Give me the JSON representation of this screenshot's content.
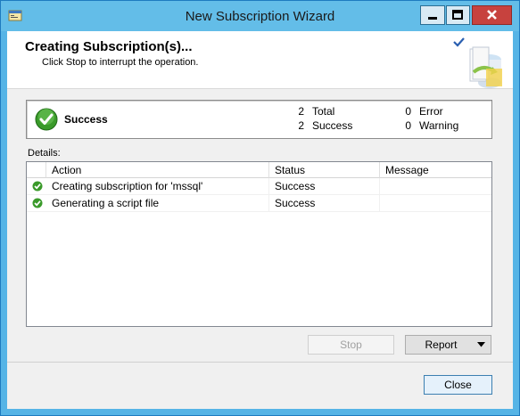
{
  "window": {
    "title": "New Subscription Wizard"
  },
  "header": {
    "title": "Creating Subscription(s)...",
    "subtitle": "Click Stop to interrupt the operation."
  },
  "summary": {
    "status": "Success",
    "total_count": "2",
    "total_label": "Total",
    "success_count": "2",
    "success_label": "Success",
    "error_count": "0",
    "error_label": "Error",
    "warning_count": "0",
    "warning_label": "Warning"
  },
  "details": {
    "label": "Details:",
    "columns": {
      "action": "Action",
      "status": "Status",
      "message": "Message"
    },
    "rows": [
      {
        "action": "Creating subscription for 'mssql'",
        "status": "Success",
        "message": ""
      },
      {
        "action": "Generating a script file",
        "status": "Success",
        "message": ""
      }
    ]
  },
  "buttons": {
    "stop": "Stop",
    "report": "Report",
    "close": "Close"
  },
  "colors": {
    "titlebar": "#63bde8",
    "success_green": "#3a9a2a",
    "close_button": "#c7423e"
  }
}
